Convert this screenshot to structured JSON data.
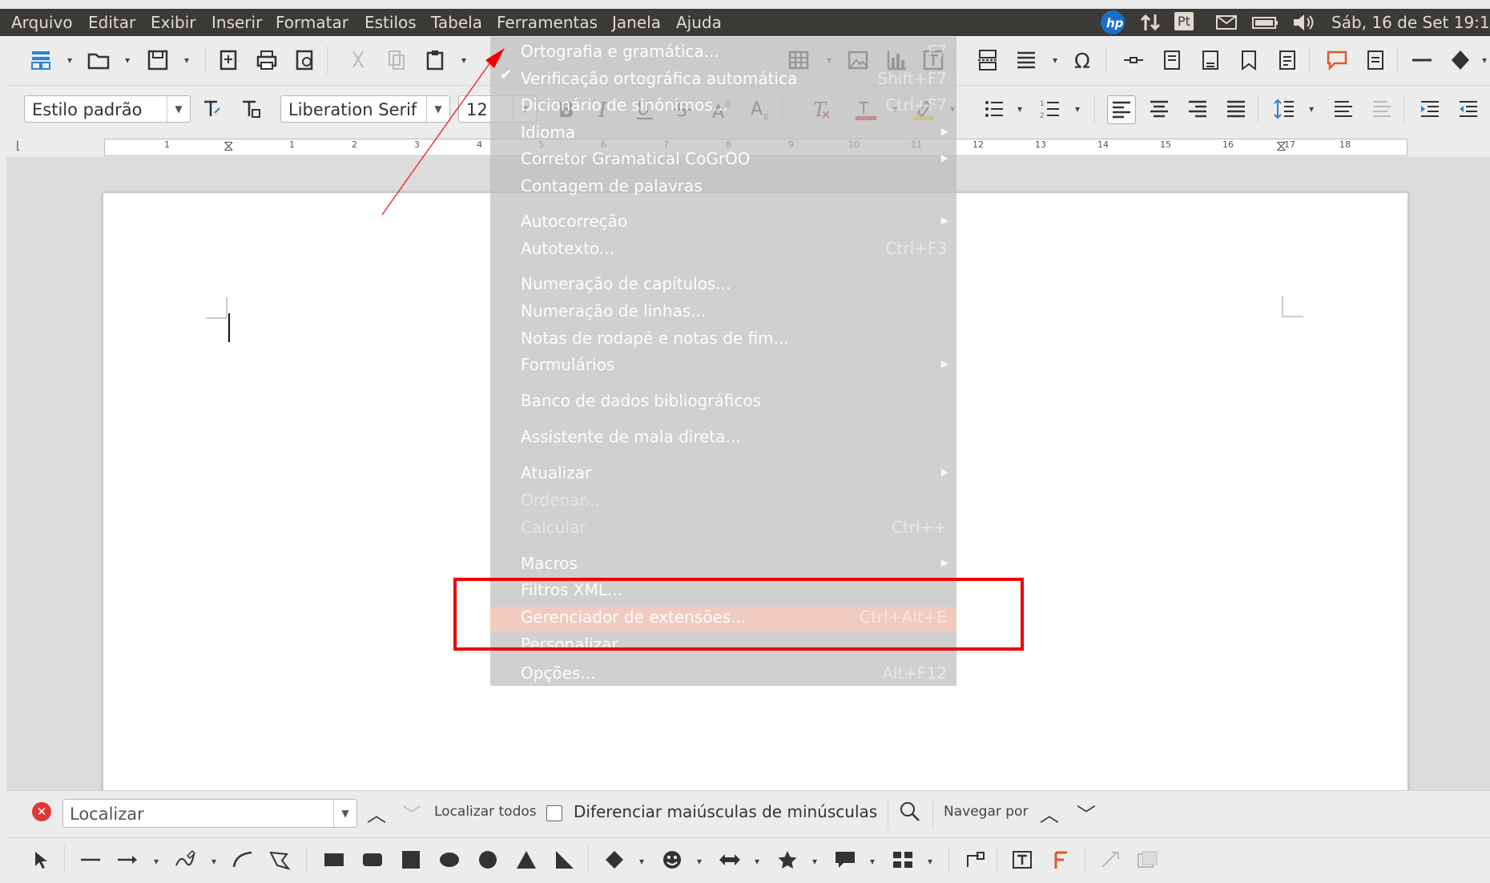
{
  "menubar": {
    "items": [
      "Arquivo",
      "Editar",
      "Exibir",
      "Inserir",
      "Formatar",
      "Estilos",
      "Tabela",
      "Ferramentas",
      "Janela",
      "Ajuda"
    ],
    "tray": {
      "hp_logo": "hp",
      "keyboard_layout": "Pt",
      "datetime": "Sáb, 16 de Set 19:10"
    }
  },
  "formatting": {
    "paragraph_style": "Estilo padrão",
    "font_name": "Liberation Serif",
    "font_size": "12"
  },
  "ruler": {
    "numbers": [
      "1",
      "1",
      "2",
      "3",
      "4",
      "5",
      "6",
      "7",
      "8",
      "9",
      "10",
      "11",
      "12",
      "13",
      "14",
      "15",
      "16",
      "17",
      "18"
    ]
  },
  "tools_menu": {
    "items": [
      {
        "label": "Ortografia e gramática...",
        "shortcut": "F7"
      },
      {
        "label": "Verificação ortográfica automática",
        "shortcut": "Shift+F7",
        "checked": true
      },
      {
        "label": "Dicionário de sinônimos...",
        "shortcut": "Ctrl+F7"
      },
      {
        "label": "Idioma",
        "submenu": true
      },
      {
        "label": "Corretor Gramatical CoGrOO",
        "submenu": true
      },
      {
        "label": "Contagem de palavras"
      },
      {
        "label": "Autocorreção",
        "submenu": true
      },
      {
        "label": "Autotexto...",
        "shortcut": "Ctrl+F3"
      },
      {
        "label": "Numeração de capítulos..."
      },
      {
        "label": "Numeração de linhas..."
      },
      {
        "label": "Notas de rodapé e notas de fim..."
      },
      {
        "label": "Formulários",
        "submenu": true
      },
      {
        "label": "Banco de dados bibliográficos"
      },
      {
        "label": "Assistente de mala direta..."
      },
      {
        "label": "Atualizar",
        "submenu": true
      },
      {
        "label": "Ordenar...",
        "disabled": true
      },
      {
        "label": "Calcular",
        "shortcut": "Ctrl++",
        "disabled": true
      },
      {
        "label": "Macros",
        "submenu": true
      },
      {
        "label": "Filtros XML..."
      },
      {
        "label": "Gerenciador de extensões...",
        "shortcut": "Ctrl+Alt+E",
        "highlighted": true
      },
      {
        "label": "Personalizar..."
      },
      {
        "label": "Opções...",
        "shortcut": "Alt+F12"
      }
    ]
  },
  "findbar": {
    "placeholder": "Localizar",
    "find_all": "Localizar todos",
    "match_case": "Diferenciar maiúsculas de minúsculas",
    "navigate_by": "Navegar por"
  },
  "colors": {
    "menubar_bg": "#3b3a36",
    "annotation_red": "#ee0000",
    "highlight": "#ffc8b9"
  }
}
